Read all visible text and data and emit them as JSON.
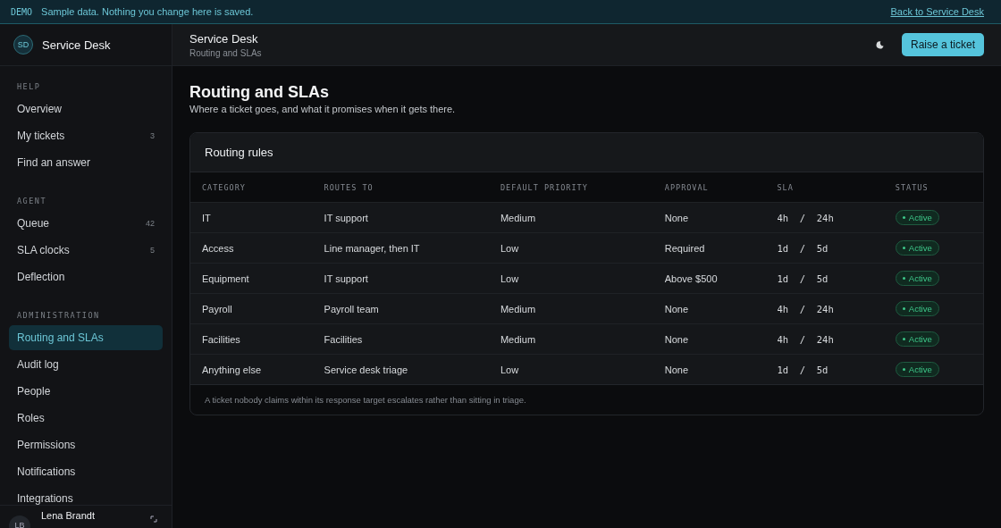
{
  "banner": {
    "tag": "DEMO",
    "message": "Sample data. Nothing you change here is saved.",
    "link": "Back to Service Desk"
  },
  "brand": {
    "initials": "SD",
    "name": "Service Desk"
  },
  "sidebar": {
    "sections": [
      {
        "heading": "HELP",
        "items": [
          {
            "label": "Overview",
            "selected": false
          },
          {
            "label": "My tickets",
            "count": "3",
            "selected": false
          },
          {
            "label": "Find an answer",
            "selected": false
          }
        ]
      },
      {
        "heading": "AGENT",
        "items": [
          {
            "label": "Queue",
            "count": "42",
            "selected": false
          },
          {
            "label": "SLA clocks",
            "count": "5",
            "selected": false
          },
          {
            "label": "Deflection",
            "selected": false
          }
        ]
      },
      {
        "heading": "ADMINISTRATION",
        "items": [
          {
            "label": "Routing and SLAs",
            "selected": true
          },
          {
            "label": "Audit log",
            "selected": false
          },
          {
            "label": "People",
            "selected": false
          },
          {
            "label": "Roles",
            "selected": false
          },
          {
            "label": "Permissions",
            "selected": false
          },
          {
            "label": "Notifications",
            "selected": false
          },
          {
            "label": "Integrations",
            "selected": false
          }
        ]
      }
    ]
  },
  "user": {
    "initials": "LB",
    "name": "Lena Brandt"
  },
  "header": {
    "title": "Service Desk",
    "subtitle": "Routing and SLAs",
    "button": "Raise a ticket"
  },
  "page": {
    "title": "Routing and SLAs",
    "subtitle": "Where a ticket goes, and what it promises when it gets there."
  },
  "card": {
    "title": "Routing rules",
    "columns": [
      "CATEGORY",
      "ROUTES TO",
      "DEFAULT PRIORITY",
      "APPROVAL",
      "SLA",
      "STATUS"
    ],
    "rows": [
      {
        "category": "IT",
        "routes_to": "IT support",
        "priority": "Medium",
        "approval": "None",
        "sla": "4h  /  24h",
        "status": "Active"
      },
      {
        "category": "Access",
        "routes_to": "Line manager, then IT",
        "priority": "Low",
        "approval": "Required",
        "sla": "1d  /  5d",
        "status": "Active"
      },
      {
        "category": "Equipment",
        "routes_to": "IT support",
        "priority": "Low",
        "approval": "Above $500",
        "sla": "1d  /  5d",
        "status": "Active"
      },
      {
        "category": "Payroll",
        "routes_to": "Payroll team",
        "priority": "Medium",
        "approval": "None",
        "sla": "4h  /  24h",
        "status": "Active"
      },
      {
        "category": "Facilities",
        "routes_to": "Facilities",
        "priority": "Medium",
        "approval": "None",
        "sla": "4h  /  24h",
        "status": "Active"
      },
      {
        "category": "Anything else",
        "routes_to": "Service desk triage",
        "priority": "Low",
        "approval": "None",
        "sla": "1d  /  5d",
        "status": "Active"
      }
    ],
    "footnote": "A ticket nobody claims within its response target escalates rather than sitting in triage."
  }
}
